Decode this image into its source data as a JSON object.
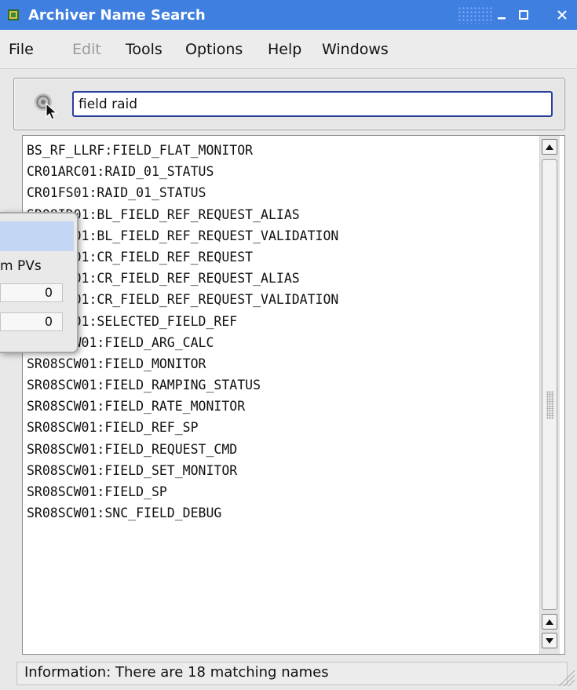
{
  "window": {
    "title": "Archiver Name Search"
  },
  "titlebar": {
    "minimize": "‗",
    "maximize": "□",
    "close": "✕"
  },
  "menu": {
    "items": [
      "File",
      "Edit",
      "Tools",
      "Options",
      "Help",
      "Windows"
    ],
    "disabled": [
      "Edit"
    ]
  },
  "search": {
    "value": "field raid",
    "placeholder": ""
  },
  "results": [
    "BS_RF_LLRF:FIELD_FLAT_MONITOR",
    "CR01ARC01:RAID_01_STATUS",
    "CR01FS01:RAID_01_STATUS",
    "SR08ID01:BL_FIELD_REF_REQUEST_ALIAS",
    "SR08ID01:BL_FIELD_REF_REQUEST_VALIDATION",
    "SR08ID01:CR_FIELD_REF_REQUEST",
    "SR08ID01:CR_FIELD_REF_REQUEST_ALIAS",
    "SR08ID01:CR_FIELD_REF_REQUEST_VALIDATION",
    "SR08ID01:SELECTED_FIELD_REF",
    "SR08SCW01:FIELD_ARG_CALC",
    "SR08SCW01:FIELD_MONITOR",
    "SR08SCW01:FIELD_RAMPING_STATUS",
    "SR08SCW01:FIELD_RATE_MONITOR",
    "SR08SCW01:FIELD_REF_SP",
    "SR08SCW01:FIELD_REQUEST_CMD",
    "SR08SCW01:FIELD_SET_MONITOR",
    "SR08SCW01:FIELD_SP",
    "SR08SCW01:SNC_FIELD_DEBUG"
  ],
  "status": {
    "text": "Information: There are 18 matching names"
  },
  "overlay": {
    "label": "m PVs",
    "field1": "0",
    "field2": "0"
  },
  "colors": {
    "titlebar": "#3f7fe0",
    "input_border": "#2a3f9c",
    "overlay_header": "#c3d7f5"
  }
}
